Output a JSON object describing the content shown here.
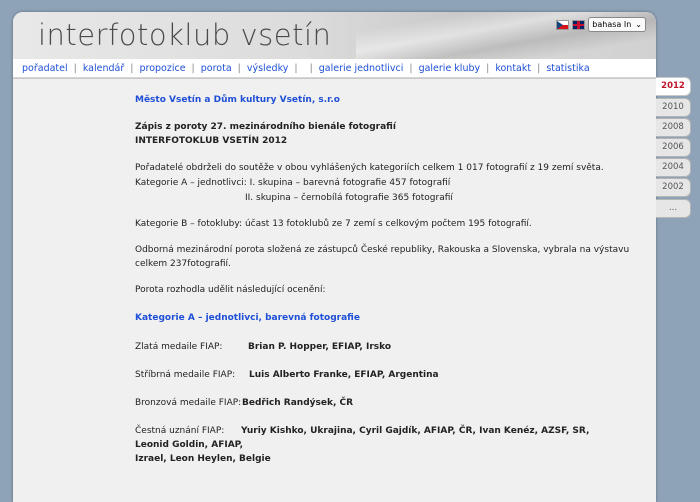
{
  "header": {
    "title": "interfotoklub vsetín",
    "language_selected": "bahasa In",
    "language_chevron": "⌄"
  },
  "nav": {
    "items": [
      "pořadatel",
      "kalendář",
      "propozice",
      "porota",
      "výsledky",
      "",
      "galerie jednotlivci",
      "galerie kluby",
      "kontakt",
      "statistika"
    ]
  },
  "year_tabs": [
    "2012",
    "2010",
    "2008",
    "2006",
    "2004",
    "2002",
    "..."
  ],
  "content": {
    "organizer": "Město Vsetín a Dům kultury Vsetín, s.r.o",
    "heading1": "Zápis z poroty 27. mezinárodního bienále fotografií",
    "heading2": "INTERFOTOKLUB VSETÍN 2012",
    "intro": "Pořadatelé obdrželi do soutěže v obou vyhlášených kategoriích celkem 1 017 fotografií z 19 zemí světa.",
    "cat_a_line1": "Kategorie A – jednotlivci: I. skupina – barevná fotografie 457 fotografií",
    "cat_a_line2": "II. skupina – černobílá fotografie 365 fotografií",
    "cat_b": "Kategorie B – fotokluby:   účast 13 fotoklubů ze 7 zemí s celkovým počtem 195 fotografií.",
    "jury_line1": "Odborná mezinárodní porota složená ze zástupců České republiky, Rakouska a Slovenska, vybrala na výstavu",
    "jury_line2": "celkem 237fotografií.",
    "jury_decided": "Porota rozhodla udělit následující ocenění:",
    "cat_a_color_heading": "Kategorie A – jednotlivci, barevná fotografie",
    "gold_label": "Zlatá medaile FIAP:",
    "gold_winner": "Brian P. Hopper, EFIAP, Irsko",
    "silver_label": "Stříbrná medaile FIAP:",
    "silver_winner": "Luis Alberto Franke, EFIAP, Argentina",
    "bronze_label": "Bronzová medaile FIAP:",
    "bronze_winner": "Bedřich Randýsek, ČR",
    "honor_label": "Čestná uznání FIAP:",
    "honor_line1": "Yuriy Kishko, Ukrajina, Cyril Gajdík,  AFIAP, ČR,  Ivan Kenéz,   AZSF, SR,",
    "honor_line2": "Leonid Goldin, AFIAP,",
    "honor_line3": "Izrael, Leon Heylen, Belgie"
  }
}
